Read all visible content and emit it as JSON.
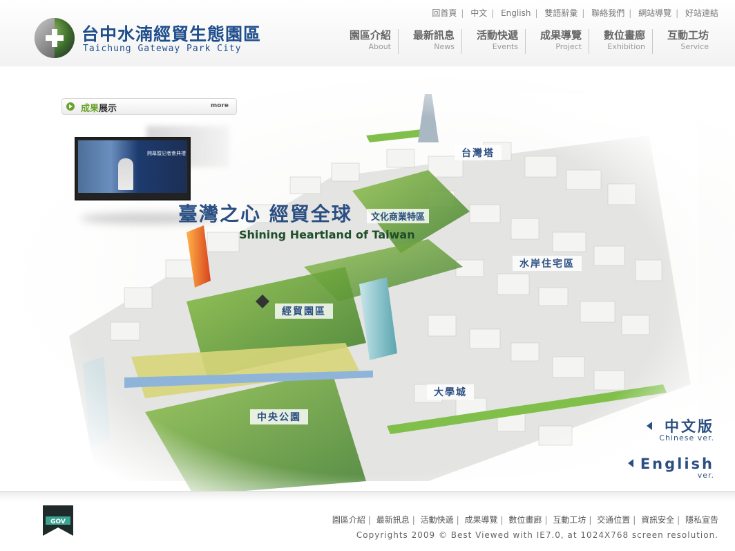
{
  "site": {
    "title_zh": "台中水湳經貿生態園區",
    "title_en": "Taichung Gateway Park City"
  },
  "top_links": [
    "回首頁",
    "中文",
    "English",
    "雙語辭彙",
    "聯絡我們",
    "網站導覽",
    "好站連結"
  ],
  "nav": [
    {
      "zh": "園區介紹",
      "en": "About"
    },
    {
      "zh": "最新訊息",
      "en": "News"
    },
    {
      "zh": "活動快遞",
      "en": "Events"
    },
    {
      "zh": "成果導覽",
      "en": "Project"
    },
    {
      "zh": "數位畫廊",
      "en": "Exhibition"
    },
    {
      "zh": "互動工坊",
      "en": "Service"
    }
  ],
  "showcase": {
    "title_hl": "成果",
    "title_rest": "展示",
    "more": "more",
    "video_caption": "開幕暨記者會典禮"
  },
  "slogan": {
    "zh": "臺灣之心  經貿全球",
    "en": "Shining Heartland of Taiwan"
  },
  "zones": [
    "台灣塔",
    "文化商業特區",
    "水岸住宅區",
    "經貿園區",
    "大學城",
    "中央公園"
  ],
  "lang_switch": {
    "zh_big": "中文版",
    "zh_small": "Chinese ver.",
    "en_big": "English",
    "en_small": "ver."
  },
  "footer": {
    "gov_label": "GOV",
    "links": [
      "園區介紹",
      "最新訊息",
      "活動快遞",
      "成果導覽",
      "數位畫廊",
      "互動工坊",
      "交通位置",
      "資訊安全",
      "隱私宣告"
    ],
    "copyright": "Copyrights 2009 © Best Viewed with IE7.0, at 1024X768 screen resolution."
  }
}
